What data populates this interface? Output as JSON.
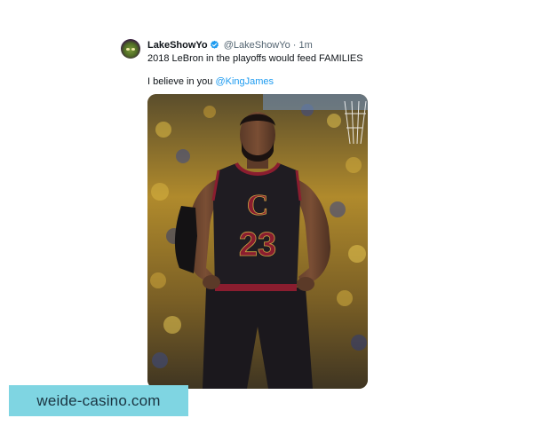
{
  "tweet": {
    "display_name": "LakeShowYo",
    "handle": "@LakeShowYo",
    "separator": "·",
    "time": "1m",
    "text_line1": "2018 LeBron in the playoffs would feed FAMILIES",
    "text_line2_prefix": "I believe in you ",
    "mention": "@KingJames",
    "colors": {
      "text": "#0f1419",
      "secondary": "#536471",
      "link": "#1d9bf0"
    }
  },
  "photo": {
    "jersey_number": "23",
    "jersey_logo": "C",
    "colors": {
      "jersey": "#1f1c22",
      "trim": "#8a1d2f",
      "crowd": "#c9a233"
    }
  },
  "watermark": {
    "text": "weide-casino.com",
    "background": "#7fd5e2"
  }
}
